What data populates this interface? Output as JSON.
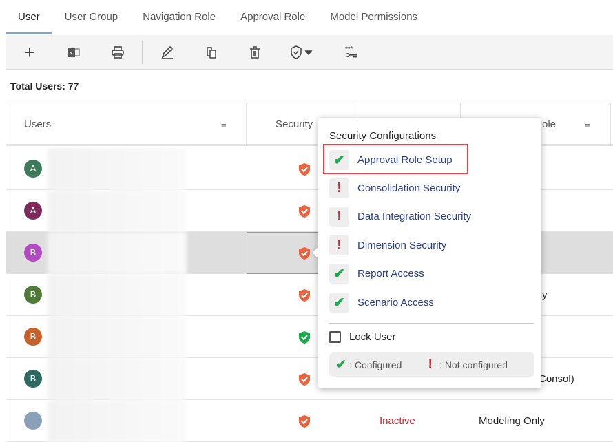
{
  "tabs": [
    "User",
    "User Group",
    "Navigation Role",
    "Approval Role",
    "Model Permissions"
  ],
  "toolbar": {
    "icons": [
      "plus-icon",
      "excel-icon",
      "print-icon",
      "edit-icon",
      "copy-icon",
      "delete-icon",
      "shield-dropdown-icon",
      "password-key-icon"
    ]
  },
  "total_users": "Total Users: 77",
  "columns": {
    "users": "Users",
    "security": "Security",
    "role": "ole"
  },
  "rows": [
    {
      "initial": "A",
      "color": "#3d7a5a",
      "shield": "#e8633f",
      "c4": ""
    },
    {
      "initial": "A",
      "color": "#7b2a5a",
      "shield": "#e8633f",
      "c4": ""
    },
    {
      "initial": "B",
      "color": "#b04ac0",
      "shield": "#e8633f",
      "c4": ""
    },
    {
      "initial": "B",
      "color": "#4f7a3a",
      "shield": "#e8633f",
      "c4": "y"
    },
    {
      "initial": "B",
      "color": "#c8602a",
      "shield": "#1aaa4a",
      "c4": ""
    },
    {
      "initial": "B",
      "color": "#2e6a60",
      "shield": "#e8633f",
      "c4": "Consol)"
    },
    {
      "initial": "",
      "color": "#8aa0b8",
      "shield": "#e8633f",
      "c3": "Inactive",
      "c4": "Modeling Only"
    }
  ],
  "popup": {
    "title": "Security Configurations",
    "items": [
      {
        "label": "Approval Role Setup",
        "status": "configured"
      },
      {
        "label": "Consolidation Security",
        "status": "not_configured"
      },
      {
        "label": "Data Integration Security",
        "status": "not_configured"
      },
      {
        "label": "Dimension Security",
        "status": "not_configured"
      },
      {
        "label": "Report Access",
        "status": "configured"
      },
      {
        "label": "Scenario Access",
        "status": "configured"
      }
    ],
    "lock_user": "Lock User",
    "lock_checked": false,
    "legend_configured": ": Configured",
    "legend_not_configured": ": Not configured"
  },
  "colors": {
    "configured": "#1aaa4a",
    "not_configured": "#e0202a",
    "link": "#2a3f8f",
    "inactive": "#d0202a"
  }
}
